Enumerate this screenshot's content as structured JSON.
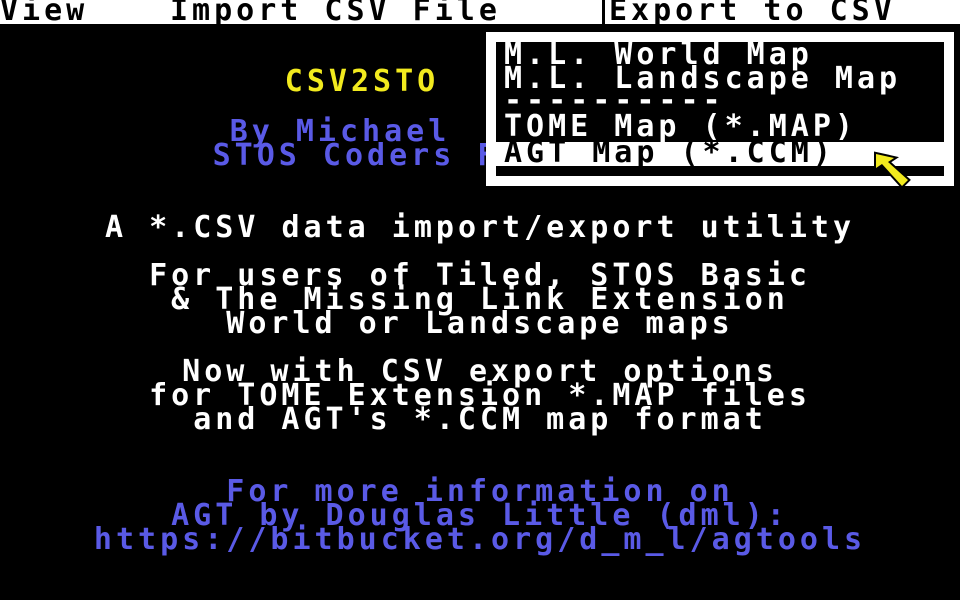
{
  "menubar": {
    "view_label": "View",
    "import_label": "Import CSV File",
    "export_label": "Export to CSV"
  },
  "dropdown": {
    "items": [
      "M.L. World Map",
      "M.L. Landscape Map",
      "----------",
      "TOME Map (*.MAP)",
      "AGT Map (*.CCM)"
    ],
    "selected_index": 4
  },
  "header": {
    "title": "CSV2STO",
    "author": "By Michael",
    "group": "STOS Coders F"
  },
  "body": {
    "tagline": "A *.CSV data import/export utility",
    "users_lines": [
      "For users of Tiled, STOS Basic",
      "& The Missing Link Extension",
      "World or Landscape maps"
    ],
    "export_lines": [
      "Now with CSV export options",
      "for TOME Extension *.MAP files",
      "and AGT's *.CCM map format"
    ],
    "info_lines": [
      "For more information on",
      "AGT by Douglas Little (dml):",
      "https://bitbucket.org/d_m_l/agtools"
    ]
  },
  "colors": {
    "background": "#000000",
    "title": "#f2ea1e",
    "credits": "#5a5ae6",
    "text": "#ffffff",
    "menu_bg": "#ffffff",
    "menu_text": "#000000"
  },
  "icons": {
    "pointer": "arrow-cursor-icon"
  }
}
